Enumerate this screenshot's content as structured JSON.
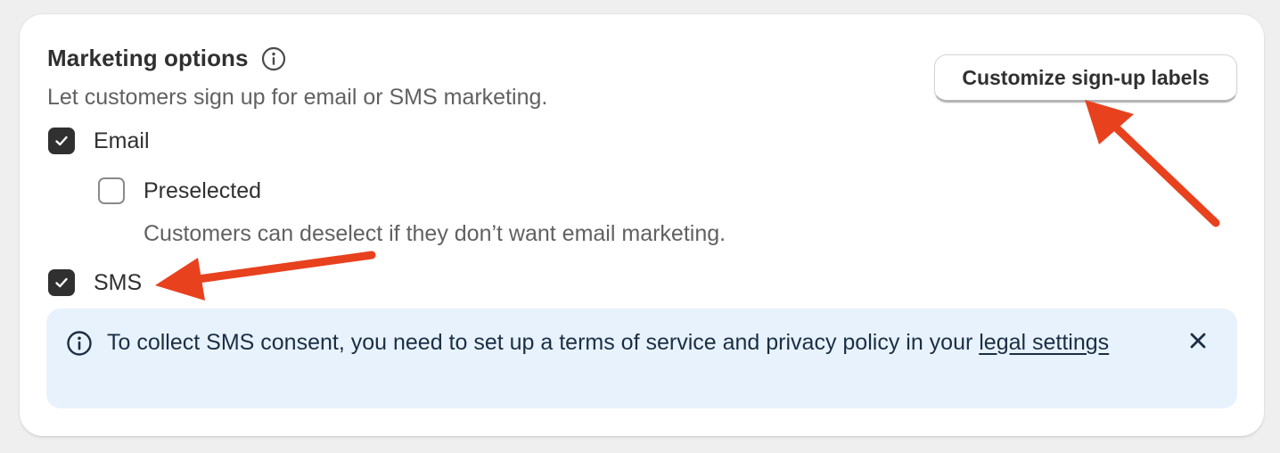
{
  "section": {
    "title": "Marketing options",
    "subtitle": "Let customers sign up for email or SMS marketing.",
    "title_info_icon": "info-circle-icon"
  },
  "actions": {
    "customize_label": "Customize sign-up labels"
  },
  "options": {
    "email": {
      "label": "Email",
      "checked": true
    },
    "preselected": {
      "label": "Preselected",
      "checked": false,
      "help": "Customers can deselect if they don’t want email marketing."
    },
    "sms": {
      "label": "SMS",
      "checked": true
    }
  },
  "banner": {
    "icon": "info-circle-icon",
    "text": "To collect SMS consent, you need to set up a terms of service and privacy policy in your ",
    "link_text": "legal settings",
    "close_icon": "close-icon",
    "background": "#e8f2fd"
  },
  "annotations": {
    "arrow_color": "#e8411e"
  }
}
